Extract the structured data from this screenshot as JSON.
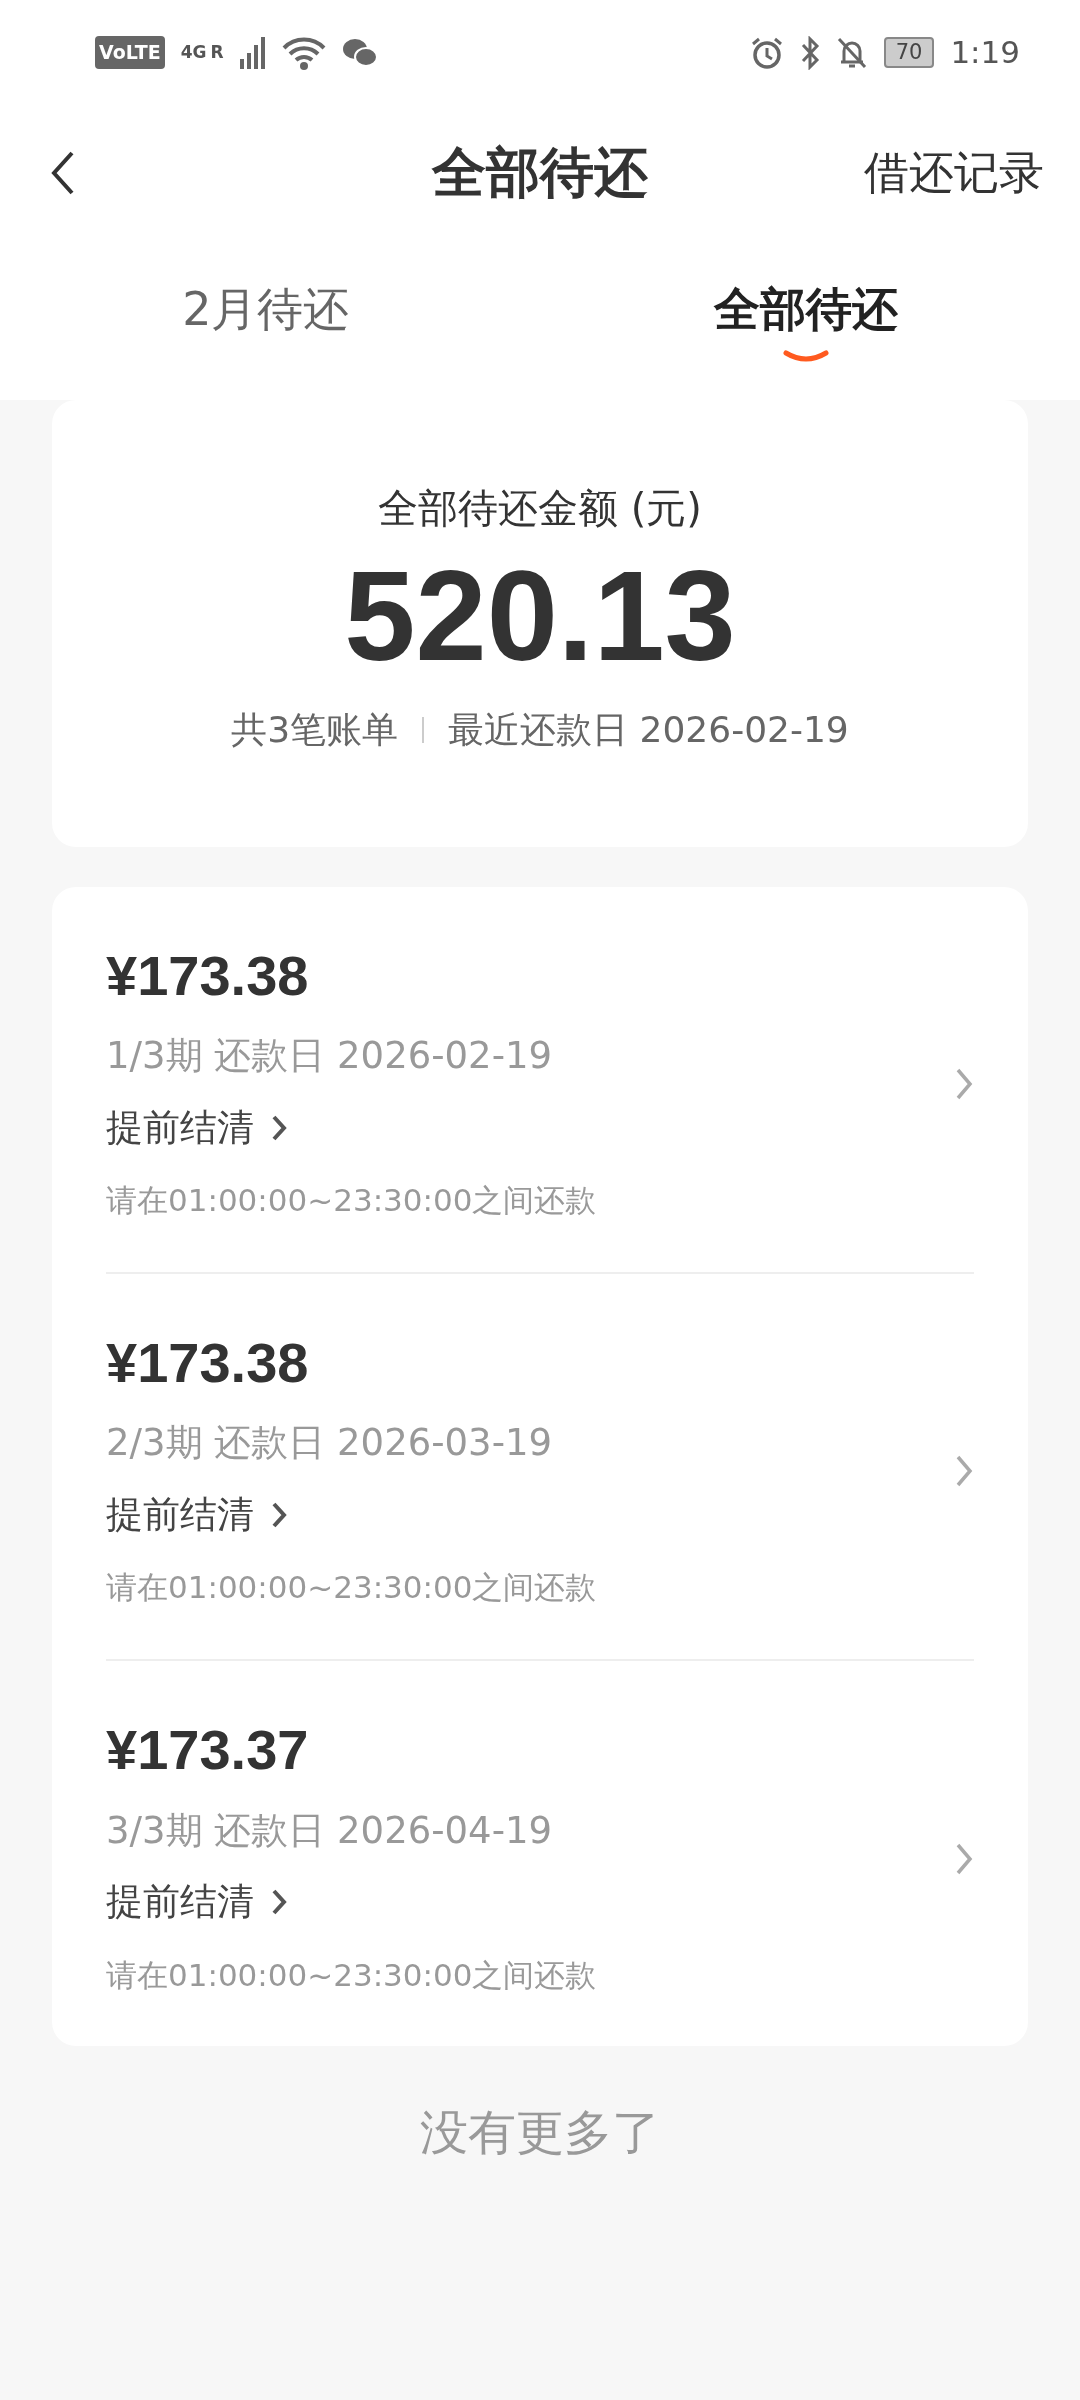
{
  "status_bar": {
    "volte": "VoLTE",
    "network": "4G",
    "roaming": "R",
    "battery": "70",
    "time": "1:19"
  },
  "header": {
    "title": "全部待还",
    "action": "借还记录"
  },
  "tabs": [
    {
      "label": "2月待还",
      "selected": false
    },
    {
      "label": "全部待还",
      "selected": true
    }
  ],
  "summary": {
    "label": "全部待还金额 (元)",
    "amount": "520.13",
    "count": "共3笔账单",
    "next_due": "最近还款日 2026-02-19"
  },
  "bills": [
    {
      "amount": "¥173.38",
      "period": "1/3期 还款日 2026-02-19",
      "action": "提前结清",
      "note": "请在01:00:00~23:30:00之间还款"
    },
    {
      "amount": "¥173.38",
      "period": "2/3期 还款日 2026-03-19",
      "action": "提前结清",
      "note": "请在01:00:00~23:30:00之间还款"
    },
    {
      "amount": "¥173.37",
      "period": "3/3期 还款日 2026-04-19",
      "action": "提前结清",
      "note": "请在01:00:00~23:30:00之间还款"
    }
  ],
  "footer": "没有更多了"
}
